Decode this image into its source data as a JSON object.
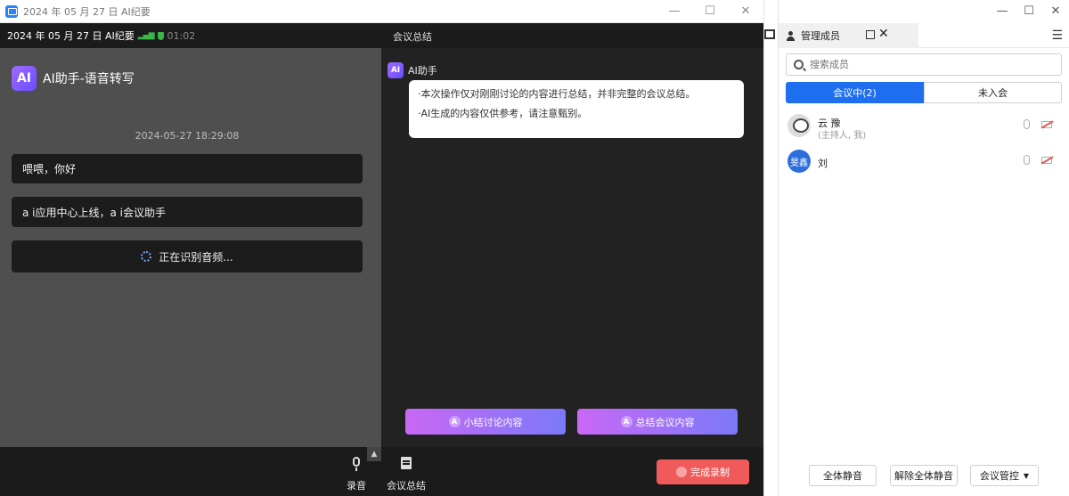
{
  "window": {
    "title": "2024 年 05 月 27 日 AI纪要",
    "controls": [
      "—",
      "☐",
      "✕"
    ]
  },
  "meeting_bar": {
    "name": "2024 年 05 月 27 日 AI纪要",
    "timer": "01:02",
    "summary_title": "会议总结"
  },
  "transcript": {
    "header": "AI助手-语音转写",
    "logo": "AI",
    "timestamp": "2024-05-27 18:29:08",
    "messages": [
      "喂喂，你好",
      "a i应用中心上线，a i会议助手"
    ],
    "status": "正在识别音频..."
  },
  "summary": {
    "assistant_name": "AI助手",
    "logo": "AI",
    "notice_line1": "·本次操作仅对刚刚讨论的内容进行总结，并非完整的会议总结。",
    "notice_line2": "·AI生成的内容仅供参考，请注意甄别。",
    "btn_discussion": "小结讨论内容",
    "btn_meeting": "总结会议内容"
  },
  "toolbar": {
    "record_label": "录音",
    "summary_label": "会议总结",
    "finish_label": "完成录制"
  },
  "members_panel": {
    "title": "管理成员",
    "controls": [
      "—",
      "☐",
      "✕"
    ],
    "search_placeholder": "搜索成员",
    "tab_in_meeting": "会议中(2)",
    "tab_not_joined": "未入会",
    "members": [
      {
        "name": "云        豫",
        "role": "(主持人, 我)"
      },
      {
        "name": "刘",
        "avatar_text": "旻鑫"
      }
    ],
    "mute_all": "全体静音",
    "unmute_all": "解除全体静音",
    "meeting_control": "会议管控"
  }
}
